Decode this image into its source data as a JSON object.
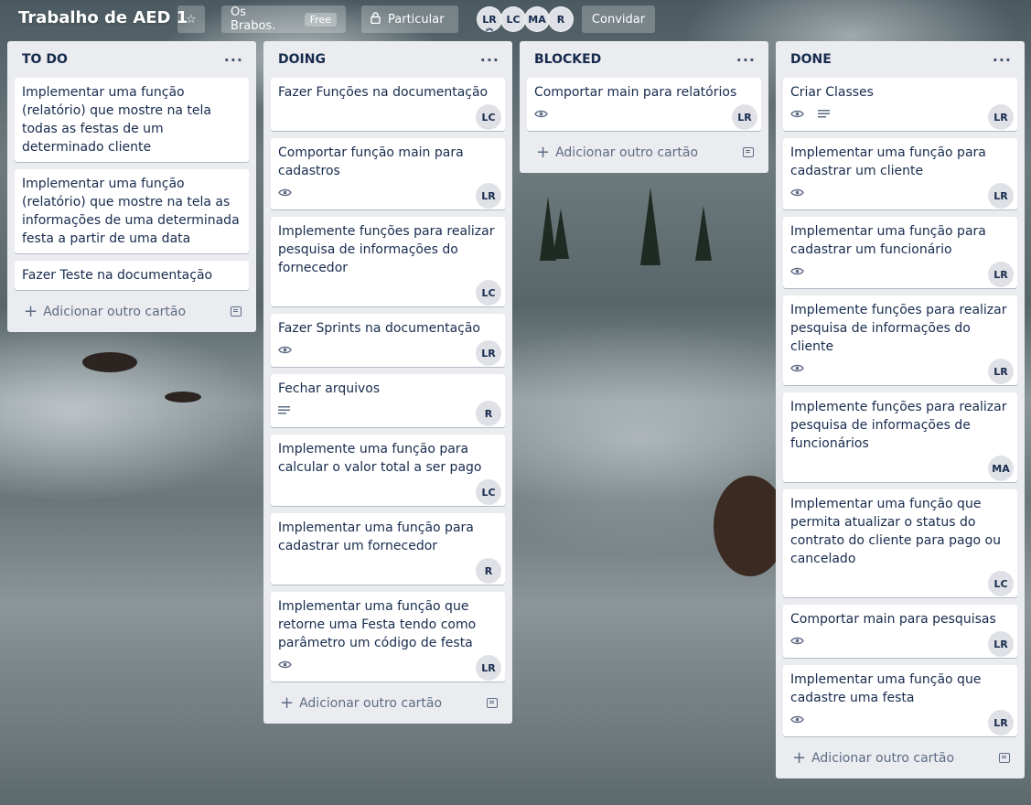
{
  "header": {
    "board_title": "Trabalho de AED 1",
    "team_name": "Os Brabos.",
    "team_plan": "Free",
    "visibility": "Particular",
    "invite_label": "Convidar",
    "members": [
      "LR",
      "LC",
      "MA",
      "R"
    ]
  },
  "lists": [
    {
      "title": "TO DO",
      "cards": [
        {
          "title": "Implementar uma função (relatório) que mostre na tela todas as festas de um determinado cliente"
        },
        {
          "title": "Implementar uma função (relatório) que mostre na tela as informações de uma determinada festa a partir de uma data"
        },
        {
          "title": "Fazer Teste na documentação"
        }
      ],
      "add_label": "Adicionar outro cartão"
    },
    {
      "title": "DOING",
      "cards": [
        {
          "title": "Fazer Funções na documentação",
          "member": "LC"
        },
        {
          "title": "Comportar função main para cadastros",
          "member": "LR",
          "icons": [
            "eye-icon"
          ]
        },
        {
          "title": "Implemente funções para realizar pesquisa de informações do fornecedor",
          "member": "LC"
        },
        {
          "title": "Fazer Sprints na documentação",
          "member": "LR",
          "icons": [
            "eye-icon"
          ]
        },
        {
          "title": "Fechar arquivos",
          "member": "R",
          "icons": [
            "description-icon"
          ]
        },
        {
          "title": "Implemente uma função para calcular o valor total a ser pago",
          "member": "LC"
        },
        {
          "title": "Implementar uma função para cadastrar um fornecedor",
          "member": "R"
        },
        {
          "title": "Implementar uma função que retorne uma Festa tendo como parâmetro um código de festa",
          "member": "LR",
          "icons": [
            "eye-icon"
          ]
        }
      ],
      "add_label": "Adicionar outro cartão"
    },
    {
      "title": "BLOCKED",
      "cards": [
        {
          "title": "Comportar main para relatórios",
          "member": "LR",
          "icons": [
            "eye-icon"
          ]
        }
      ],
      "add_label": "Adicionar outro cartão"
    },
    {
      "title": "DONE",
      "cards": [
        {
          "title": "Criar Classes",
          "member": "LR",
          "icons": [
            "eye-icon",
            "description-icon"
          ]
        },
        {
          "title": "Implementar uma função para cadastrar um cliente",
          "member": "LR",
          "icons": [
            "eye-icon"
          ]
        },
        {
          "title": "Implementar uma função para cadastrar um funcionário",
          "member": "LR",
          "icons": [
            "eye-icon"
          ]
        },
        {
          "title": "Implemente funções para realizar pesquisa de informações do cliente",
          "member": "LR",
          "icons": [
            "eye-icon"
          ]
        },
        {
          "title": "Implemente funções para realizar pesquisa de informações de funcionários",
          "member": "MA"
        },
        {
          "title": "Implementar uma função que permita atualizar o status do contrato do cliente para pago ou cancelado",
          "member": "LC"
        },
        {
          "title": "Comportar main para pesquisas",
          "member": "LR",
          "icons": [
            "eye-icon"
          ]
        },
        {
          "title": "Implementar uma função que cadastre uma festa",
          "member": "LR",
          "icons": [
            "eye-icon"
          ]
        }
      ],
      "add_label": "Adicionar outro cartão"
    }
  ]
}
